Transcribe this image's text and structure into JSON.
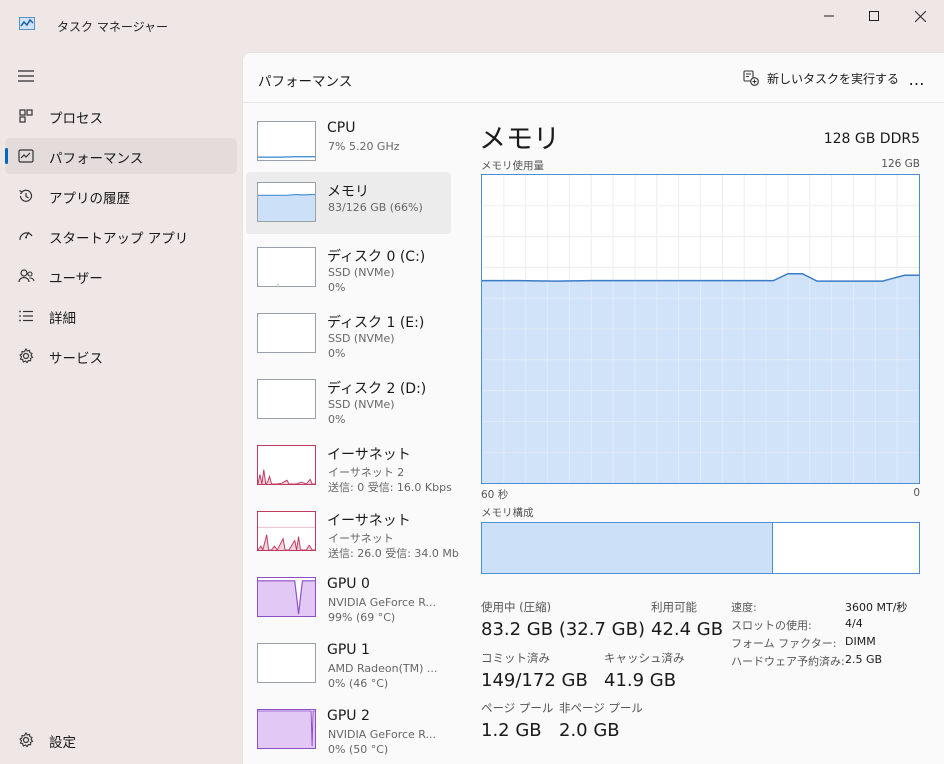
{
  "window": {
    "title": "タスク マネージャー"
  },
  "sidebar": {
    "items": [
      {
        "label": "プロセス",
        "icon": "processes-icon",
        "active": false
      },
      {
        "label": "パフォーマンス",
        "icon": "performance-icon",
        "active": true
      },
      {
        "label": "アプリの履歴",
        "icon": "history-icon",
        "active": false
      },
      {
        "label": "スタートアップ アプリ",
        "icon": "startup-icon",
        "active": false
      },
      {
        "label": "ユーザー",
        "icon": "users-icon",
        "active": false
      },
      {
        "label": "詳細",
        "icon": "details-icon",
        "active": false
      },
      {
        "label": "サービス",
        "icon": "services-icon",
        "active": false
      }
    ],
    "settings_label": "設定"
  },
  "header": {
    "title": "パフォーマンス",
    "new_task_label": "新しいタスクを実行する",
    "more_label": "…"
  },
  "resources": [
    {
      "name": "CPU",
      "sub1": "7%  5.20 GHz",
      "sub2": "",
      "sub3": ""
    },
    {
      "name": "メモリ",
      "sub1": "83/126 GB (66%)",
      "sub2": "",
      "sub3": ""
    },
    {
      "name": "ディスク 0 (C:)",
      "sub1": "SSD (NVMe)",
      "sub2": "0%",
      "sub3": ""
    },
    {
      "name": "ディスク 1 (E:)",
      "sub1": "SSD (NVMe)",
      "sub2": "0%",
      "sub3": ""
    },
    {
      "name": "ディスク 2 (D:)",
      "sub1": "SSD (NVMe)",
      "sub2": "0%",
      "sub3": ""
    },
    {
      "name": "イーサネット",
      "sub1": "イーサネット 2",
      "sub2": "送信: 0 受信: 16.0 Kbps",
      "sub3": ""
    },
    {
      "name": "イーサネット",
      "sub1": "イーサネット",
      "sub2": "送信: 26.0 受信: 34.0 Mb",
      "sub3": ""
    },
    {
      "name": "GPU 0",
      "sub1": "NVIDIA GeForce R...",
      "sub2": "99% (69 °C)",
      "sub3": ""
    },
    {
      "name": "GPU 1",
      "sub1": "AMD Radeon(TM) ...",
      "sub2": "0% (46 °C)",
      "sub3": ""
    },
    {
      "name": "GPU 2",
      "sub1": "NVIDIA GeForce R...",
      "sub2": "0% (50 °C)",
      "sub3": ""
    }
  ],
  "detail": {
    "title": "メモリ",
    "spec": "128 GB DDR5",
    "usage_label": "メモリ使用量",
    "usage_max": "126 GB",
    "time_left": "60 秒",
    "time_right": "0",
    "composition_label": "メモリ構成",
    "composition_used_fraction": 0.665,
    "stats": {
      "in_use_label": "使用中 (圧縮)",
      "in_use_value": "83.2 GB (32.7 GB)",
      "available_label": "利用可能",
      "available_value": "42.4 GB",
      "committed_label": "コミット済み",
      "committed_value": "149/172 GB",
      "cached_label": "キャッシュ済み",
      "cached_value": "41.9 GB",
      "paged_label": "ページ プール",
      "paged_value": "1.2 GB",
      "nonpaged_label": "非ページ プール",
      "nonpaged_value": "2.0 GB"
    },
    "specs": [
      {
        "key": "速度:",
        "value": "3600 MT/秒"
      },
      {
        "key": "スロットの使用:",
        "value": "4/4"
      },
      {
        "key": "フォーム ファクター:",
        "value": "DIMM"
      },
      {
        "key": "ハードウェア予約済み:",
        "value": "2.5 GB"
      }
    ]
  },
  "chart_data": {
    "type": "area",
    "title": "メモリ使用量",
    "ylabel": "",
    "xlabel": "",
    "ylim": [
      0,
      126
    ],
    "xlim": [
      60,
      0
    ],
    "x": [
      60,
      55,
      50,
      45,
      40,
      35,
      30,
      25,
      20,
      18,
      16,
      14,
      12,
      10,
      5,
      2,
      0
    ],
    "series": [
      {
        "values": [
          82.8,
          82.8,
          82.6,
          82.8,
          82.8,
          82.8,
          82.8,
          82.8,
          82.8,
          85.6,
          85.6,
          82.6,
          82.6,
          82.6,
          82.6,
          85.0,
          85.0
        ]
      }
    ],
    "grid": true,
    "colors": {
      "fill": "#cce0f7",
      "line": "#3a7cc9",
      "grid": "#e6e6e6"
    }
  },
  "colors": {
    "accent": "#0067c0",
    "memory_fill": "#cce0f7",
    "memory_line": "#4a90d9",
    "ethernet_line": "#c0395f",
    "gpu_fill": "#e2c9f5",
    "gpu_line": "#8c4fc7"
  }
}
